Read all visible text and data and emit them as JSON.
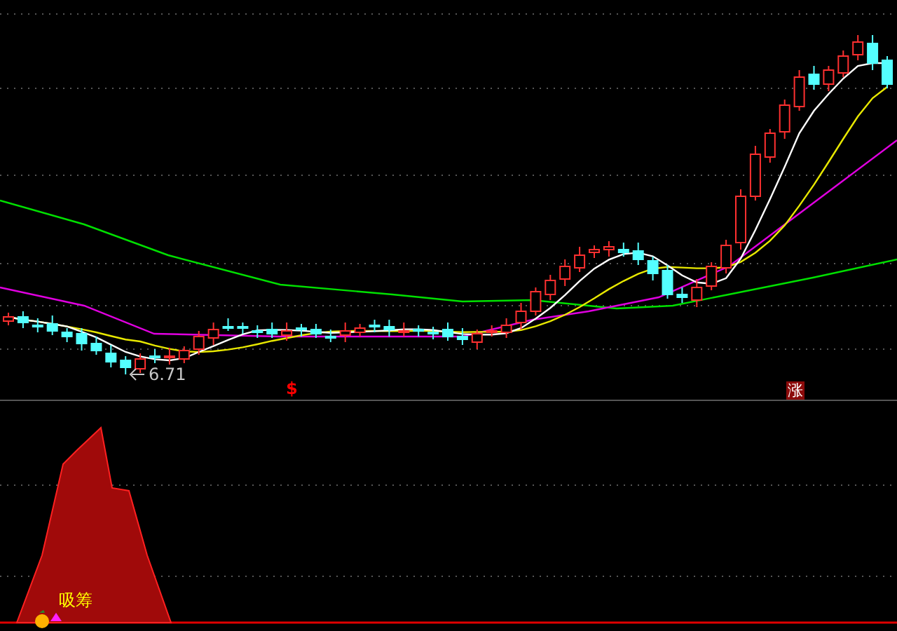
{
  "price_chart": {
    "low_label": "6.71",
    "signal_marker": "$",
    "rise_badge": "涨"
  },
  "indicator_chart": {
    "label": "吸筹"
  }
}
